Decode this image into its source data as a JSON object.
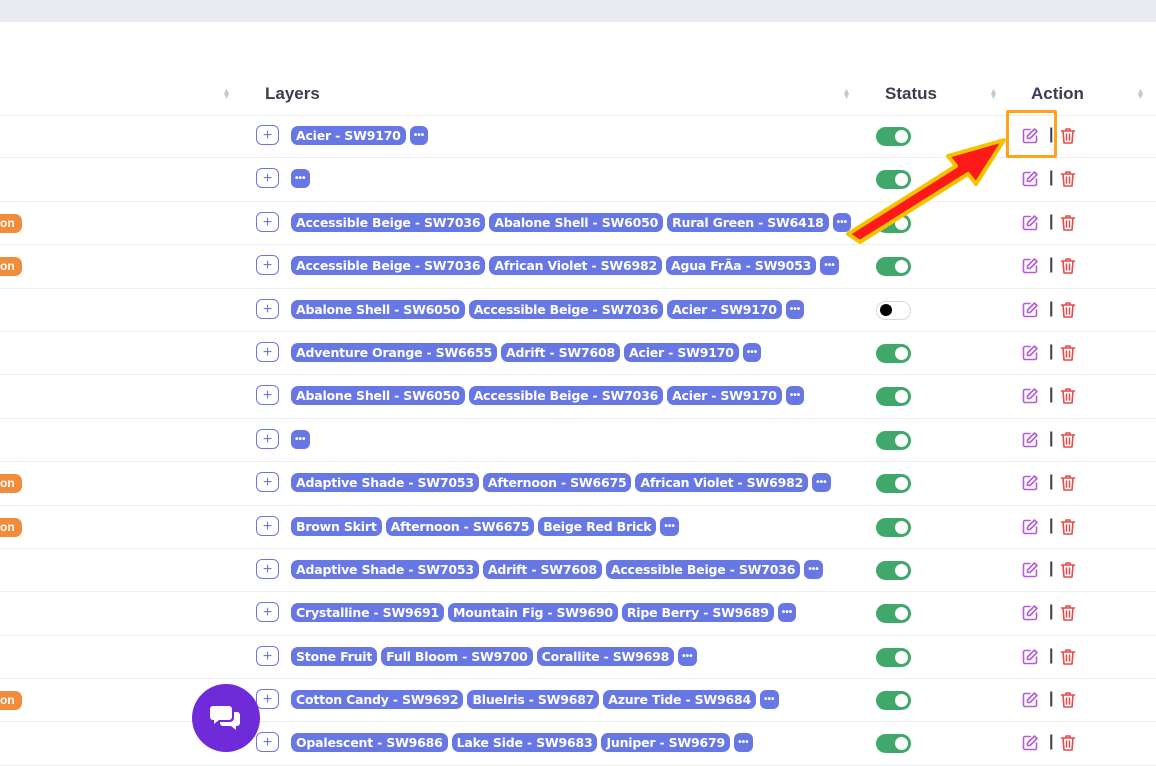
{
  "header": {
    "col_layers": "Layers",
    "col_status": "Status",
    "col_action": "Action"
  },
  "plus_label": "+",
  "more_label": "•••",
  "rows": [
    {
      "badge": "",
      "chips": [
        "Acier - SW9170"
      ],
      "status": "on"
    },
    {
      "badge": "",
      "chips": [],
      "status": "on"
    },
    {
      "badge": "on",
      "chips": [
        "Accessible Beige - SW7036",
        "Abalone Shell - SW6050",
        "Rural Green - SW6418"
      ],
      "status": "on"
    },
    {
      "badge": "on",
      "chips": [
        "Accessible Beige - SW7036",
        "African Violet - SW6982",
        "Agua FrÃ­a - SW9053"
      ],
      "status": "on"
    },
    {
      "badge": "",
      "chips": [
        "Abalone Shell - SW6050",
        "Accessible Beige - SW7036",
        "Acier - SW9170"
      ],
      "status": "off"
    },
    {
      "badge": "",
      "chips": [
        "Adventure Orange - SW6655",
        "Adrift - SW7608",
        "Acier - SW9170"
      ],
      "status": "on"
    },
    {
      "badge": "",
      "chips": [
        "Abalone Shell - SW6050",
        "Accessible Beige - SW7036",
        "Acier - SW9170"
      ],
      "status": "on"
    },
    {
      "badge": "",
      "chips": [],
      "status": "on"
    },
    {
      "badge": "on",
      "chips": [
        "Adaptive Shade - SW7053",
        "Afternoon - SW6675",
        "African Violet - SW6982"
      ],
      "status": "on"
    },
    {
      "badge": "on",
      "chips": [
        "Brown Skirt",
        "Afternoon - SW6675",
        "Beige Red Brick"
      ],
      "status": "on"
    },
    {
      "badge": "",
      "chips": [
        "Adaptive Shade - SW7053",
        "Adrift - SW7608",
        "Accessible Beige - SW7036"
      ],
      "status": "on"
    },
    {
      "badge": "",
      "chips": [
        "Crystalline - SW9691",
        "Mountain Fig - SW9690",
        "Ripe Berry - SW9689"
      ],
      "status": "on"
    },
    {
      "badge": "",
      "chips": [
        "Stone Fruit",
        "Full Bloom - SW9700",
        "Corallite - SW9698"
      ],
      "status": "on"
    },
    {
      "badge": "on",
      "chips": [
        "Cotton Candy - SW9692",
        "BlueIris - SW9687",
        "Azure Tide - SW9684"
      ],
      "status": "on"
    },
    {
      "badge": "",
      "chips": [
        "Opalescent - SW9686",
        "Lake Side - SW9683",
        "Juniper - SW9679"
      ],
      "status": "on"
    }
  ],
  "colors": {
    "chip": "#6777e4",
    "toggle_on": "#3fa86a",
    "badge": "#f08c3c",
    "edit_icon": "#b55bd8",
    "delete_icon": "#e54b4b",
    "highlight": "#ffa41a",
    "arrow": "#ff1a1a",
    "chat_button": "#6f2bd9"
  },
  "icons": {
    "edit": "edit-icon",
    "delete": "trash-icon",
    "chat": "chat-icon"
  }
}
